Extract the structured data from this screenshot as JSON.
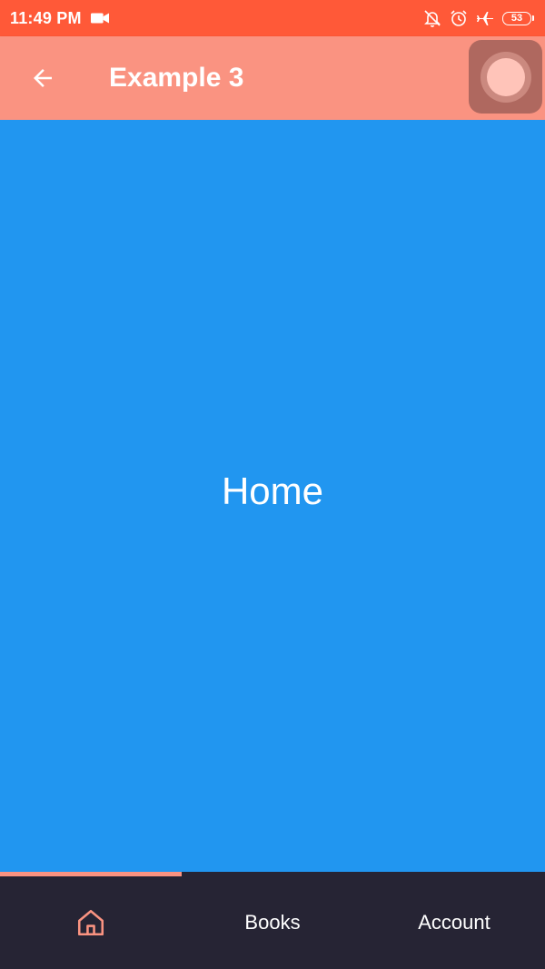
{
  "status_bar": {
    "time": "11:49 PM",
    "battery": "53",
    "icons": [
      "video-camera-icon",
      "notifications-off-icon",
      "alarm-icon",
      "airplane-icon",
      "battery-icon"
    ]
  },
  "app_bar": {
    "title": "Example 3",
    "back_icon": "arrow-back-icon"
  },
  "page": {
    "label": "Home"
  },
  "bottom_nav": {
    "items": [
      {
        "label": "",
        "icon": "home-icon",
        "selected": true
      },
      {
        "label": "Books",
        "selected": false
      },
      {
        "label": "Account",
        "selected": false
      }
    ]
  },
  "colors": {
    "status_bar": "#FF5938",
    "app_bar": "#FA9381",
    "page_background": "#2196F0",
    "bottom_nav": "#262434",
    "accent": "#FA9381"
  }
}
